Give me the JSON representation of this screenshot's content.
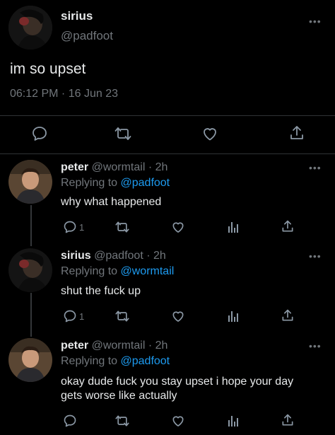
{
  "main_tweet": {
    "display_name": "sirius",
    "handle": "@padfoot",
    "text": "im so upset",
    "timestamp": "06:12 PM · 16 Jun 23",
    "more_icon": "more-dots-icon",
    "actions": [
      "reply-icon",
      "retweet-icon",
      "like-icon",
      "share-icon"
    ]
  },
  "replies": [
    {
      "display_name": "peter",
      "handle": "@wormtail",
      "dot_time": "· 2h",
      "replying_to_label": "Replying to",
      "replying_to_handle": "@padfoot",
      "text": "why what happened",
      "reply_count": "1"
    },
    {
      "display_name": "sirius",
      "handle": "@padfoot",
      "dot_time": "· 2h",
      "replying_to_label": "Replying to",
      "replying_to_handle": "@wormtail",
      "text": "shut the fuck up",
      "reply_count": "1"
    },
    {
      "display_name": "peter",
      "handle": "@wormtail",
      "dot_time": "· 2h",
      "replying_to_label": "Replying to",
      "replying_to_handle": "@padfoot",
      "text_line1": "okay dude fuck you stay upset i hope your day",
      "text_line2": "gets worse like actually",
      "reply_count": ""
    }
  ],
  "colors": {
    "background": "#000000",
    "text": "#e7e9ea",
    "muted": "#71767b",
    "link": "#1d9bf0"
  }
}
